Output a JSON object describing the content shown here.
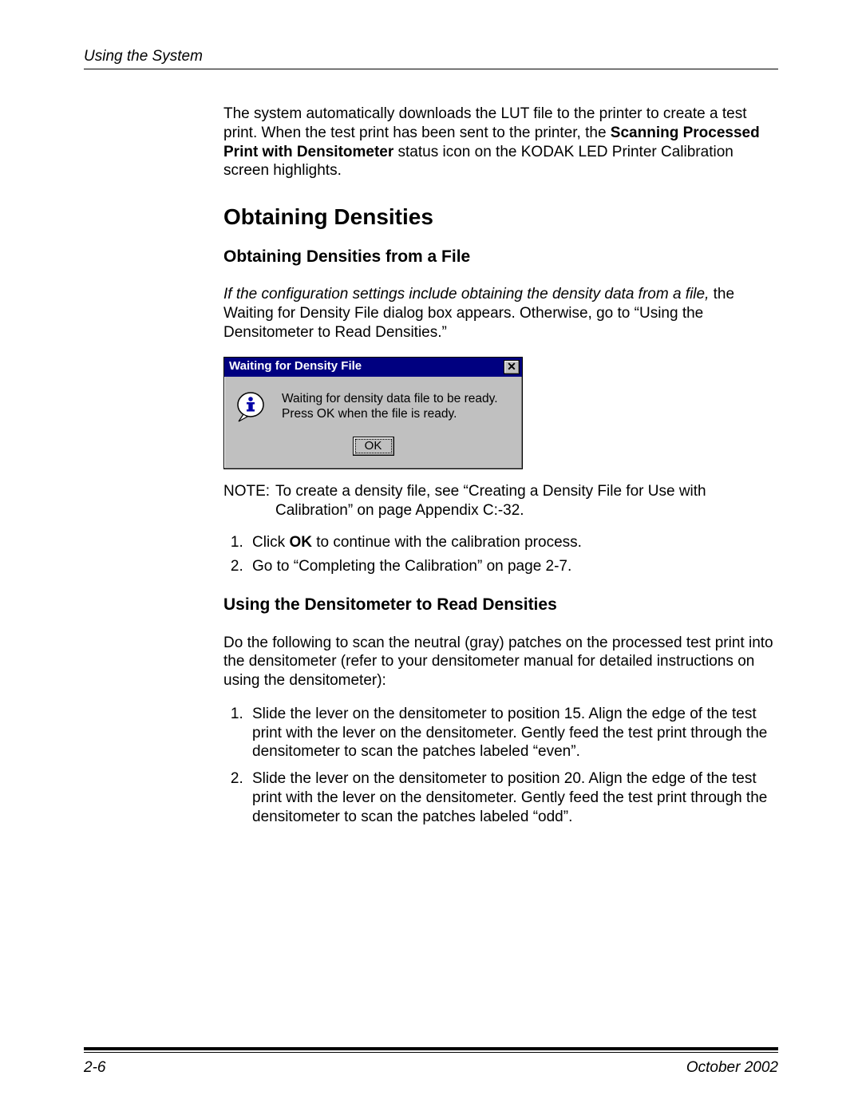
{
  "header": {
    "section": "Using the System"
  },
  "intro": {
    "p1_a": "The system automatically downloads the LUT file to the printer to create a test print. When the test print has been sent to the printer, the ",
    "p1_b": "Scanning Processed Print with Densitometer",
    "p1_c": " status icon on the KODAK LED Printer Calibration screen highlights."
  },
  "h1": "Obtaining Densities",
  "subA": {
    "title": "Obtaining Densities from a File",
    "p_it": "If the configuration settings include obtaining the density data from a file,",
    "p_rest": " the Waiting for Density File dialog box appears. Otherwise, go to “Using the Densitometer to Read Densities.”"
  },
  "dialog": {
    "title": "Waiting for Density File",
    "close": "✕",
    "line1": "Waiting for density data file to be ready.",
    "line2": "Press OK when the file is ready.",
    "ok": "OK"
  },
  "note": {
    "label": "NOTE:",
    "text": "To create a density file, see “Creating a Density File for Use with Calibration” on page Appendix C:-32."
  },
  "stepsA": {
    "s1_a": "Click ",
    "s1_b": "OK",
    "s1_c": " to continue with the calibration process.",
    "s2": "Go to “Completing the Calibration” on page 2-7."
  },
  "subB": {
    "title": "Using the Densitometer to Read Densities",
    "p": "Do the following to scan the neutral (gray) patches on the processed test print into the densitometer (refer to your densitometer manual for detailed instructions on using the densitometer):"
  },
  "stepsB": {
    "s1": "Slide the lever on the densitometer to position 15. Align the edge of the test print with the lever on the densitometer. Gently feed the test print through the densitometer to scan the patches labeled “even”.",
    "s2": "Slide the lever on the densitometer to position 20. Align the edge of the test print with the lever on the densitometer. Gently feed the test print through the densitometer to scan the patches labeled “odd”."
  },
  "footer": {
    "page": "2-6",
    "date": "October 2002"
  }
}
